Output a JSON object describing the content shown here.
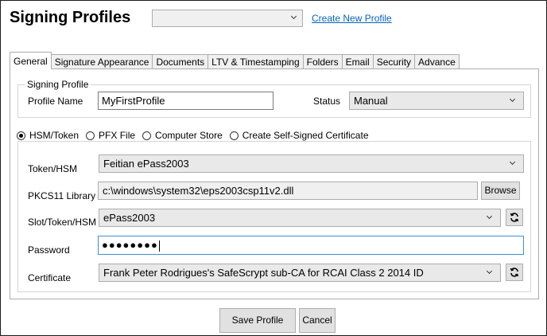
{
  "header": {
    "title": "Signing Profiles",
    "profile_select_value": "",
    "create_link": "Create New Profile"
  },
  "tabs": [
    {
      "label": "General",
      "active": true
    },
    {
      "label": "Signature Appearance",
      "active": false
    },
    {
      "label": "Documents",
      "active": false
    },
    {
      "label": "LTV & Timestamping",
      "active": false
    },
    {
      "label": "Folders",
      "active": false
    },
    {
      "label": "Email",
      "active": false
    },
    {
      "label": "Security",
      "active": false
    },
    {
      "label": "Advance",
      "active": false
    }
  ],
  "signing_profile": {
    "legend": "Signing Profile",
    "name_label": "Profile Name",
    "name_value": "MyFirstProfile",
    "status_label": "Status",
    "status_value": "Manual"
  },
  "certificate_source": {
    "options": [
      {
        "label": "HSM/Token",
        "checked": true
      },
      {
        "label": "PFX File",
        "checked": false
      },
      {
        "label": "Computer Store",
        "checked": false
      },
      {
        "label": "Create Self-Signed Certificate",
        "checked": false
      }
    ]
  },
  "hsm": {
    "token_label": "Token/HSM",
    "token_value": "Feitian ePass2003",
    "library_label": "PKCS11 Library",
    "library_value": "c:\\windows\\system32\\eps2003csp11v2.dll",
    "browse_label": "Browse",
    "slot_label": "Slot/Token/HSM",
    "slot_value": "ePass2003",
    "password_label": "Password",
    "password_value": "●●●●●●●●",
    "certificate_label": "Certificate",
    "certificate_value": "Frank Peter Rodrigues's SafeScrypt sub-CA for RCAI Class 2 2014 ID"
  },
  "footer": {
    "save_label": "Save Profile",
    "cancel_label": "Cancel"
  },
  "icons": {
    "refresh": "refresh-icon",
    "dropdown": "chevron-down-icon"
  }
}
